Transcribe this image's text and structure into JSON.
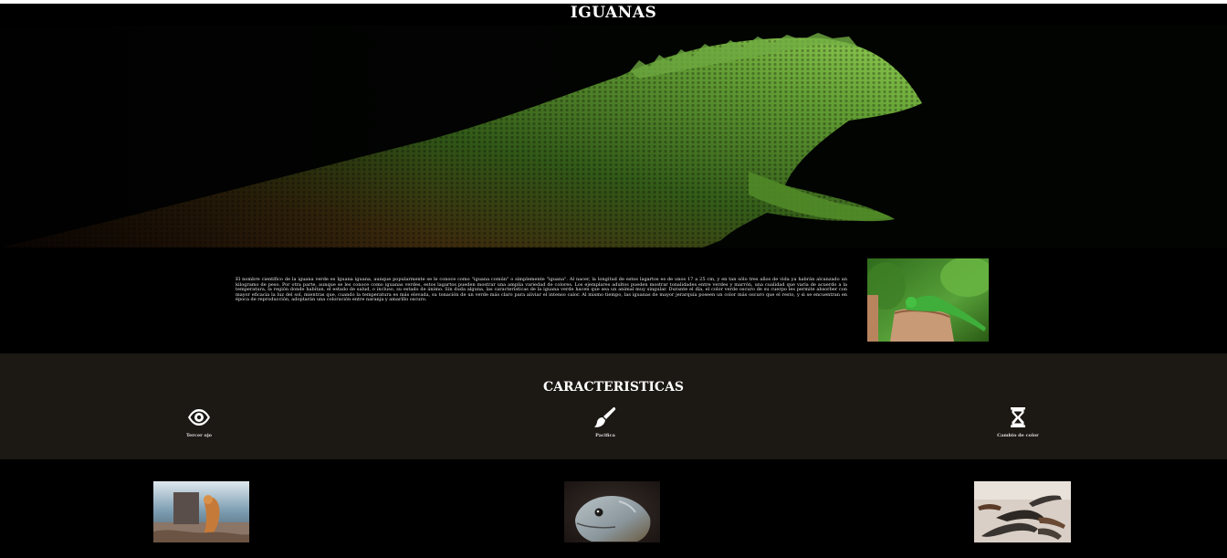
{
  "page": {
    "title": "IGUANAS"
  },
  "hero": {
    "image": "green-iguana-closeup-photo"
  },
  "intro": {
    "text": "El nombre científico de la iguana verde es Iguana iguana, aunque popularmente se le conoce como \"iguana común\" o simplemente \"iguana\". Al nacer, la longitud de estos lagartos es de unos 17 a 25 cm, y en tan sólo tres años de vida ya habrán alcanzado un kilogramo de peso. Por otra parte, aunque se les conoce como iguanas verdes, estos lagartos pueden mostrar una amplia variedad de colores. Los ejemplares adultos pueden mostrar tonalidades entre verdes y marrón, una cualidad que varía de acuerdo a la temperatura, la región donde habitan, el estado de salud, o incluso, su estado de ánimo. Sin duda alguna, las características de la iguana verde hacen que sea un animal muy singular. Durante el día, el color verde oscuro de su cuerpo les permite absorber con mayor eficacia la luz del sol, mientras que, cuando la temperatura es más elevada, su tonación de un verde más claro para aliviar el intenso calor. Al mismo tiempo, las iguanas de mayor jerarquía poseen un color más oscuro que el resto, y si se encuentran en época de reproducción, adoptarán una coloración entre naranja y amarillo oscuro.",
    "photo": "iguana-on-tree-stump-photo"
  },
  "features": {
    "heading": "CARACTERISTICAS",
    "items": [
      {
        "label": "Tercer ojo",
        "icon": "eye-icon"
      },
      {
        "label": "Pacifica",
        "icon": "paintbrush-icon"
      },
      {
        "label": "Cambio de color",
        "icon": "hourglass-icon"
      }
    ]
  },
  "gallery": {
    "photos": [
      "iguana-on-beach-photo",
      "iguana-head-portrait-photo",
      "marine-iguanas-group-photo"
    ]
  },
  "colors": {
    "page_background": "#000000",
    "features_background": "#1c1814",
    "text": "#ffffff"
  }
}
